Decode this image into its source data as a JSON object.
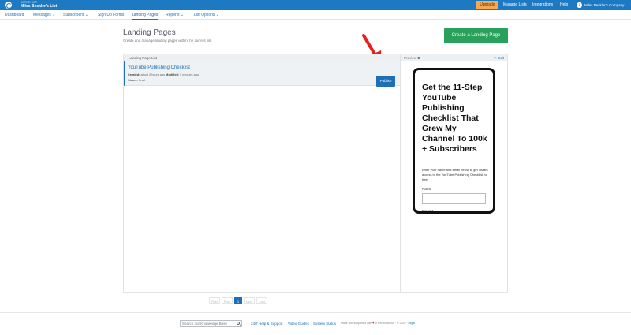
{
  "topbar": {
    "list_label": "ACTIVE LIST",
    "list_name": "Miles Beckler's List",
    "upgrade_label": "Upgrade",
    "nav": [
      {
        "label": "Manage Lists"
      },
      {
        "label": "Integrations"
      },
      {
        "label": "Help"
      }
    ],
    "company_initial": "i",
    "company": "Miles Beckler's Company"
  },
  "subnav": {
    "items": [
      {
        "label": "Dashboard"
      },
      {
        "label": "Messages ⌄"
      },
      {
        "label": "Subscribers ⌄"
      },
      {
        "label": "Sign Up Forms"
      },
      {
        "label": "Landing Pages"
      },
      {
        "label": "Reports ⌄"
      },
      {
        "label": "List Options ⌄"
      }
    ]
  },
  "page": {
    "title": "Landing Pages",
    "subtitle": "Create and manage landing pages within the current list.",
    "create_label": "Create a Landing Page"
  },
  "list_panel": {
    "header": "Landing Page List",
    "preview_label": "Preview ⧉",
    "edit_label": "✎ Edit",
    "rows": [
      {
        "title": "YouTube Publishing Checklist",
        "created_label": "Created:",
        "created": "about 2 hours ago",
        "modified_label": "Modified:",
        "modified": "9 minutes ago",
        "status_label": "Status:",
        "status": "Draft",
        "publish_label": "Publish"
      }
    ]
  },
  "preview": {
    "heading": "Get the 11-Step YouTube Publishing Checklist That Grew My Channel To 100k + Subscribers",
    "body": "Enter your name and email below to get instant access to the YouTube Publishing Checklist for free.",
    "name_label": "Name",
    "email_label": "Email *"
  },
  "pagination": {
    "first": "First",
    "prev": "Prev",
    "current": "1",
    "next": "Next",
    "last": "Last"
  },
  "footer": {
    "search_placeholder": "Search our Knowledge Base",
    "links": [
      {
        "label": "24/7 Help & Support"
      },
      {
        "label": "Video Guides"
      },
      {
        "label": "System Status"
      }
    ],
    "note_prefix": "Made and supported with",
    "note_heart": "♥",
    "note_suffix": "in Pennsylvania · © 2020 ·",
    "legal_label": "Legal"
  },
  "colors": {
    "brand_blue": "#1d7ac2",
    "create_green": "#2aa15a",
    "upgrade_orange": "#f6a852",
    "annotation_red": "#e8201a"
  }
}
